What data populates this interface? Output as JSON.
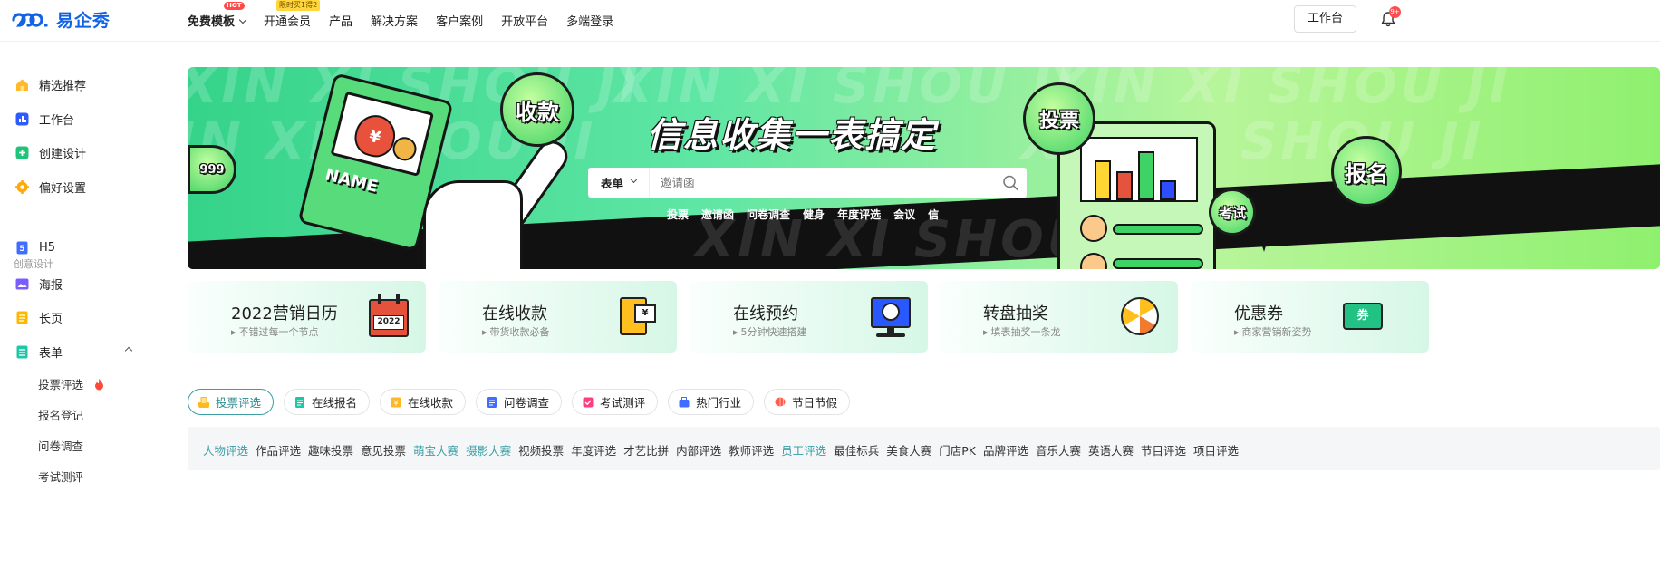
{
  "header": {
    "logo_text": "易企秀",
    "nav": [
      {
        "label": "免费模板",
        "badge": "HOT",
        "has_dropdown": true
      },
      {
        "label": "开通会员",
        "badge": "限时买1得2"
      },
      {
        "label": "产品"
      },
      {
        "label": "解决方案"
      },
      {
        "label": "客户案例"
      },
      {
        "label": "开放平台"
      },
      {
        "label": "多端登录"
      }
    ],
    "workbench_button": "工作台",
    "notification_badge": "9+"
  },
  "sidebar": {
    "items": [
      {
        "label": "精选推荐",
        "icon": "home-icon",
        "color": "#ffb92a"
      },
      {
        "label": "工作台",
        "icon": "dashboard-icon",
        "color": "#2e5bff"
      },
      {
        "label": "创建设计",
        "icon": "plus-icon",
        "color": "#1fc37a"
      },
      {
        "label": "偏好设置",
        "icon": "gear-icon",
        "color": "#ffa90a"
      }
    ],
    "section_caption": "创意设计",
    "creative_items": [
      {
        "label": "H5",
        "icon": "h5-icon",
        "color": "#3e6dff"
      },
      {
        "label": "海报",
        "icon": "poster-icon",
        "color": "#7b5cff"
      },
      {
        "label": "长页",
        "icon": "longpage-icon",
        "color": "#ffb800"
      },
      {
        "label": "表单",
        "icon": "form-icon",
        "color": "#1fc6a8",
        "expanded": true
      }
    ],
    "form_sub_items": [
      {
        "label": "投票评选",
        "hot": true
      },
      {
        "label": "报名登记"
      },
      {
        "label": "问卷调查"
      },
      {
        "label": "考试测评"
      }
    ]
  },
  "banner": {
    "slogan": "信息收集一表搞定",
    "bg_text": "XIN XI SHOU JI",
    "search": {
      "type_label": "表单",
      "placeholder": "邀请函"
    },
    "quick_links": [
      "投票",
      "邀请函",
      "问卷调查",
      "健身",
      "年度评选",
      "会议",
      "信"
    ],
    "bubbles": {
      "collect": "收款",
      "vote": "投票",
      "signup": "报名",
      "exam": "考试",
      "dots": "999",
      "card": "NAME"
    }
  },
  "feature_cards": [
    {
      "title": "2022营销日历",
      "subtitle": "不错过每一个节点",
      "icon": "calendar-icon",
      "icon_text": "2022",
      "accent": "#e4523b"
    },
    {
      "title": "在线收款",
      "subtitle": "带货收款必备",
      "icon": "payment-icon",
      "accent": "#ffbf1f"
    },
    {
      "title": "在线预约",
      "subtitle": "5分钟快速搭建",
      "icon": "appointment-icon",
      "accent": "#2a58ff"
    },
    {
      "title": "转盘抽奖",
      "subtitle": "填表抽奖一条龙",
      "icon": "lottery-wheel-icon",
      "accent": "#f07a2e"
    },
    {
      "title": "优惠券",
      "subtitle": "商家营销新姿势",
      "icon": "coupon-icon",
      "icon_text": "券",
      "accent": "#22c285"
    }
  ],
  "category_tabs": [
    {
      "label": "投票评选",
      "active": true,
      "icon": "vote-icon",
      "color": "#ffb726"
    },
    {
      "label": "在线报名",
      "icon": "signup-icon",
      "color": "#1fc6a8"
    },
    {
      "label": "在线收款",
      "icon": "payment-icon",
      "color": "#ffb726"
    },
    {
      "label": "问卷调查",
      "icon": "survey-icon",
      "color": "#3e6dff"
    },
    {
      "label": "考试测评",
      "icon": "exam-icon",
      "color": "#ff3d7f"
    },
    {
      "label": "热门行业",
      "icon": "industry-icon",
      "color": "#3e6dff"
    },
    {
      "label": "节日节假",
      "icon": "holiday-icon",
      "color": "#ff5a4a"
    }
  ],
  "sub_categories": [
    {
      "label": "人物评选",
      "highlight": true
    },
    {
      "label": "作品评选"
    },
    {
      "label": "趣味投票"
    },
    {
      "label": "意见投票"
    },
    {
      "label": "萌宝大赛",
      "highlight": true
    },
    {
      "label": "摄影大赛",
      "highlight": true
    },
    {
      "label": "视频投票"
    },
    {
      "label": "年度评选"
    },
    {
      "label": "才艺比拼"
    },
    {
      "label": "内部评选"
    },
    {
      "label": "教师评选"
    },
    {
      "label": "员工评选",
      "highlight": true
    },
    {
      "label": "最佳标兵"
    },
    {
      "label": "美食大赛"
    },
    {
      "label": "门店PK"
    },
    {
      "label": "品牌评选"
    },
    {
      "label": "音乐大赛"
    },
    {
      "label": "英语大赛"
    },
    {
      "label": "节目评选"
    },
    {
      "label": "项目评选"
    }
  ]
}
